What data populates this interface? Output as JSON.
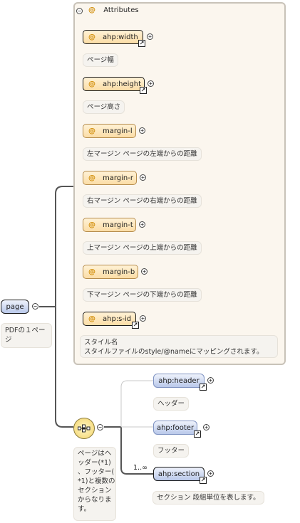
{
  "attributes_group": {
    "title": "Attributes",
    "at_symbol": "@"
  },
  "attributes": [
    {
      "name": "ahp:width",
      "description": "ページ幅"
    },
    {
      "name": "ahp:height",
      "description": "ページ高さ"
    },
    {
      "name": "margin-l",
      "description": "左マージン ページの左端からの距離"
    },
    {
      "name": "margin-r",
      "description": "右マージン ページの右端からの距離"
    },
    {
      "name": "margin-t",
      "description": "上マージン ページの上端からの距離"
    },
    {
      "name": "margin-b",
      "description": "下マージン ページの下端からの距離"
    },
    {
      "name": "ahp:s-id",
      "description_line1": "スタイル名",
      "description_line2": "スタイルファイルのstyle/@nameにマッピングされます。"
    }
  ],
  "root": {
    "name": "page",
    "description_line1": "PDFの１ペー",
    "description_line2": "ジ"
  },
  "sequence": {
    "description_lines": [
      "ページはヘ",
      "ッダー(*1)",
      "、フッター(",
      "*1)と複数の",
      "セクション",
      "からなりま",
      "す。"
    ]
  },
  "children": [
    {
      "name": "ahp:header",
      "description": "ヘッダー"
    },
    {
      "name": "ahp:footer",
      "description": "フッター"
    },
    {
      "name": "ahp:section",
      "description": "セクション 段組単位を表します。",
      "cardinality": "1..∞"
    }
  ],
  "icons": {
    "collapse": "minus-circle-icon",
    "expand": "plus-circle-icon",
    "reference": "reference-arrow-icon",
    "sequence": "sequence-compositor-icon"
  },
  "colors": {
    "attribute_fill": "#fbdda6",
    "element_fill": "#b9c8ea",
    "panel_fill": "#fbf6ee"
  }
}
